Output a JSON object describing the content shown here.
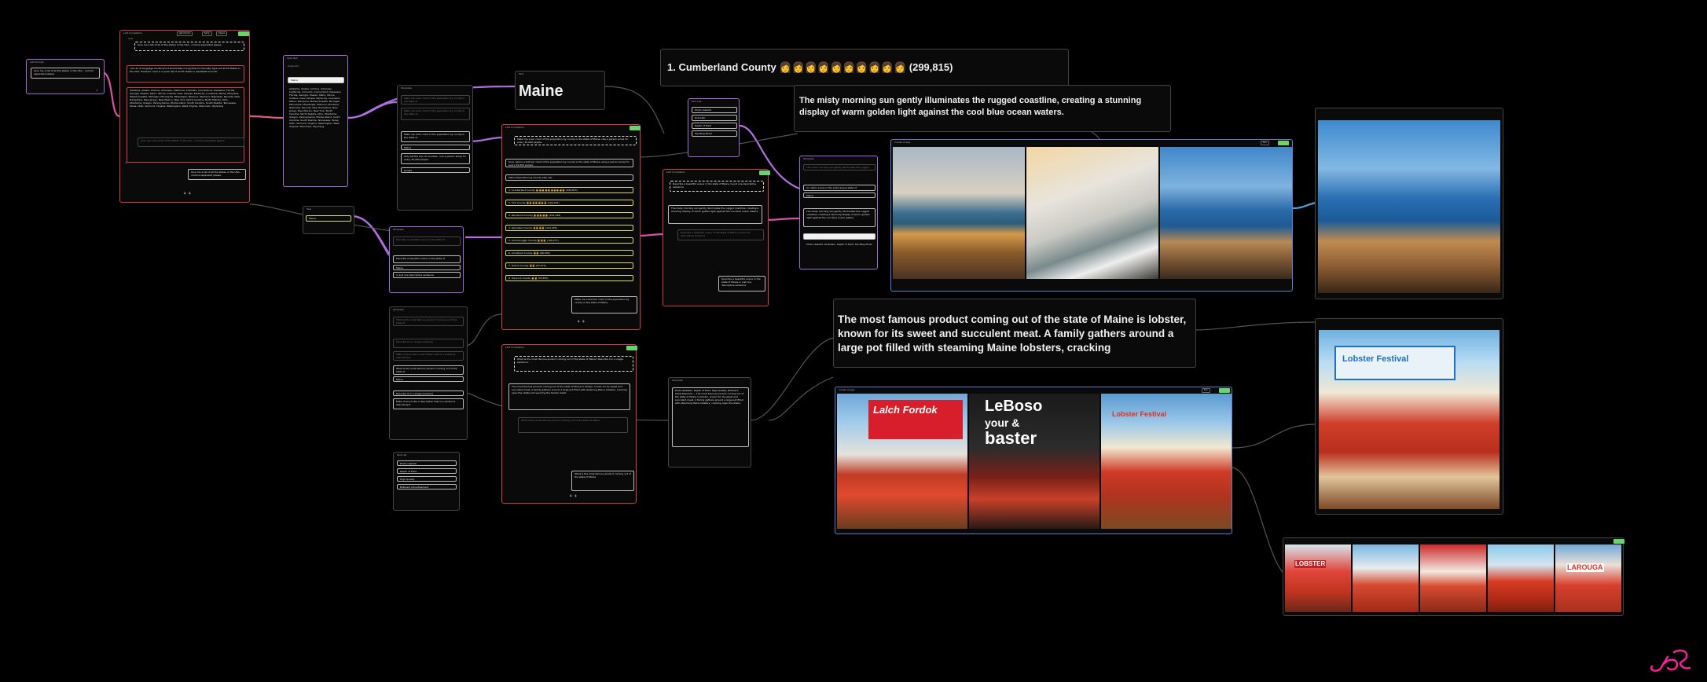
{
  "canvas": {
    "logo_icon": "jd-logo-icon",
    "accent": "#ff1fa0"
  },
  "nodes": {
    "n1": {
      "title": "LLM Prompt",
      "prompt": "Give me a list of all the states in the USA - comma separated please"
    },
    "n2": {
      "title": "LLM Completion",
      "buttons": [
        "gpt-4-turbo",
        "temp",
        "tokens"
      ],
      "tag": "user",
      "prompt": "Give me a list of all of the states in the USA - comma separated please",
      "intro": "I am an AI language model and it would take a long time to manually type out all 50 states in the USA. However, here is a quick list of all 50 states in alphabetical order:",
      "answer": "Alabama, Alaska, Arizona, Arkansas, California, Colorado, Connecticut, Delaware, Florida, Georgia, Hawaii, Idaho, Illinois, Indiana, Iowa, Kansas, Kentucky, Louisiana, Maine, Maryland, Massachusetts, Michigan, Minnesota, Mississippi, Missouri, Montana, Nebraska, Nevada, New Hampshire, New Jersey, New Mexico, New York, North Carolina, North Dakota, Ohio, Oklahoma, Oregon, Pennsylvania, Rhode Island, South Carolina, South Dakota, Tennessee, Texas, Utah, Vermont, Virginia, Washington, West Virginia, Wisconsin, Wyoming",
      "followup": "Give me a list of all of the states in the USA - comma separated please",
      "assistant_tag": "AI",
      "reply": "Give me a list of all the states in the USA - comma separated please"
    },
    "n3": {
      "title": "Split Text",
      "field": "Separator",
      "value": "Maine",
      "list": "Alabama, Alaska, Arizona, Arkansas, California, Colorado, Connecticut, Delaware, Florida, Georgia, Hawaii, Idaho, Illinois, Indiana, Iowa, Kansas, Kentucky, Louisiana, Maine, Maryland, Massachusetts, Michigan, Minnesota, Mississippi, Missouri, Montana, Nebraska, Nevada, New Hampshire, New Jersey, New Mexico, New York, North Carolina, North Dakota, Ohio, Oklahoma, Oregon, Pennsylvania, Rhode Island, South Carolina, South Dakota, Tennessee, Texas, Utah, Vermont, Virginia, Washington, West Virginia, Wisconsin, Wyoming"
    },
    "n4": {
      "title": "Text",
      "value": "Maine"
    },
    "n5": {
      "title": "Template",
      "line1": "Make me a bar chart of the population by county in the state of",
      "line2": "Make me a bar chart of the population by county in the state of",
      "value": "Maine",
      "line3": "Only list the top 10 counties - use a person emoji for every 30,000 people",
      "line4": "people"
    },
    "n6": {
      "title": "Template",
      "line1": "Describe a beautiful scene in the state of",
      "value": "Maine",
      "line2": "in just one descriptive sentence"
    },
    "n7": {
      "title": "Template",
      "line1": "What is the most famous product coming out of the state of",
      "line2": "Describe it in a single sentence",
      "q": "What is the most famous product coming out of the state of",
      "value": "Maine",
      "line3": "Describe it in a single sentence",
      "line4": "Make it sound like a description that is a sentence describing it"
    },
    "n8": {
      "title": "Text List",
      "items": [
        "Photo realistic",
        "Depth of Field",
        "High Quality",
        "Billboard Advertisement"
      ]
    },
    "maine": {
      "title": "Text",
      "value": "Maine"
    },
    "n9": {
      "title": "LLM Completion",
      "prompt": "Make me a bar chart of the population by county in the state of Maine. Use a person emoji for every 30,000 people.",
      "intro": "Sure, here's a text bar chart of the population by county in the state of Maine using a person emoji for every 30,000 people:",
      "header": "Maine Population by County (Top 10):",
      "rows": [
        "1. Cumberland County 👩👩👩👩👩👩👩👩👩👩 (299,815)",
        "2. York County 👩👩👩👩👩👩👩 (206,229)",
        "3. Penobscot County 👩👩👩👩👩 (152,199)",
        "4. Kennebec County 👩👩👩👩 (124,426)",
        "5. Androscoggin County 👩👩👩 (108,277)",
        "6. Aroostook County 👩👩 (66,405)",
        "7. Oxford County 👩👩 (57,975)",
        "8. Hancock County 👩👩 (55,853)"
      ],
      "reply": "Make me a text bar chart of the population by county in the state of Maine"
    },
    "n10": {
      "title": "LLM Completion",
      "prompt": "What is the most famous product coming out of the state of Maine? Describe it in a single sentence.",
      "answer": "The most famous product coming out of the state of Maine is lobster, known for its sweet and succulent meat. A family gathers around a large pot filled with steaming Maine lobsters, cracking open the shells and savoring the tender meat.",
      "followup": "What is the most famous product coming out of the state of Maine",
      "reply": "What is the most famous product coming out of the state of Maine"
    },
    "n11": {
      "title": "Text List",
      "items": [
        "Photo realistic",
        "Dramatic",
        "Depth of Field",
        "Top Blog Photo"
      ]
    },
    "n12": {
      "title": "LLM Completion",
      "prompt": "Describe a beautiful scene in the state of Maine in just one descriptive sentence.",
      "answer": "The misty morning sun gently illuminates the rugged coastline, creating a stunning display of warm golden light against the cool blue ocean waters.",
      "followup": "Describe a beautiful scene in the state of Maine in just one descriptive sentence",
      "reply": "Describe a beautiful scene in the state of Maine in just one descriptive sentence"
    },
    "n13": {
      "title": "Template",
      "line1": "An idyllic scene in the picturesque state of",
      "value": "Maine",
      "body": "The misty morning sun gently illuminates the rugged coastline, creating a stunning display of warm golden light against the cool blue ocean waters.",
      "tags": "Photo realistic, Dramatic, Depth of Field, Top Blog Photo"
    },
    "n14": {
      "title": "Template",
      "body": "Photo Realistic, Depth of Field, High Quality, Billboard Advertisement — The most famous product coming out of the state of Maine is lobster, known for its sweet and succulent meat. A family gathers around a large pot filled with steaming Maine lobsters, cracking open the shells."
    },
    "cumberland": {
      "text": "1. Cumberland County 👩👩👩👩👩👩👩👩👩👩 (299,815)"
    },
    "scene_text": {
      "text": "The misty morning sun gently illuminates the rugged coastline, creating a stunning display of warm golden light against the cool blue ocean waters."
    },
    "lobster_text": {
      "text": "The most famous product coming out of the state of Maine is lobster, known for its sweet and succulent meat.  A family gathers around a large pot filled with steaming Maine lobsters, cracking"
    },
    "gen_coast": {
      "title": "Create Image",
      "btn": "Run"
    },
    "gen_lobster": {
      "title": "Create Image",
      "btn": "Run"
    },
    "lobster_signs": {
      "s1": "Lalch Fordok",
      "s2": "LeBoso",
      "s3": "your &",
      "s4": "baster",
      "s5": "Lobster Festival",
      "s6": "LOBSTER",
      "s7": "LAROUGA"
    }
  }
}
